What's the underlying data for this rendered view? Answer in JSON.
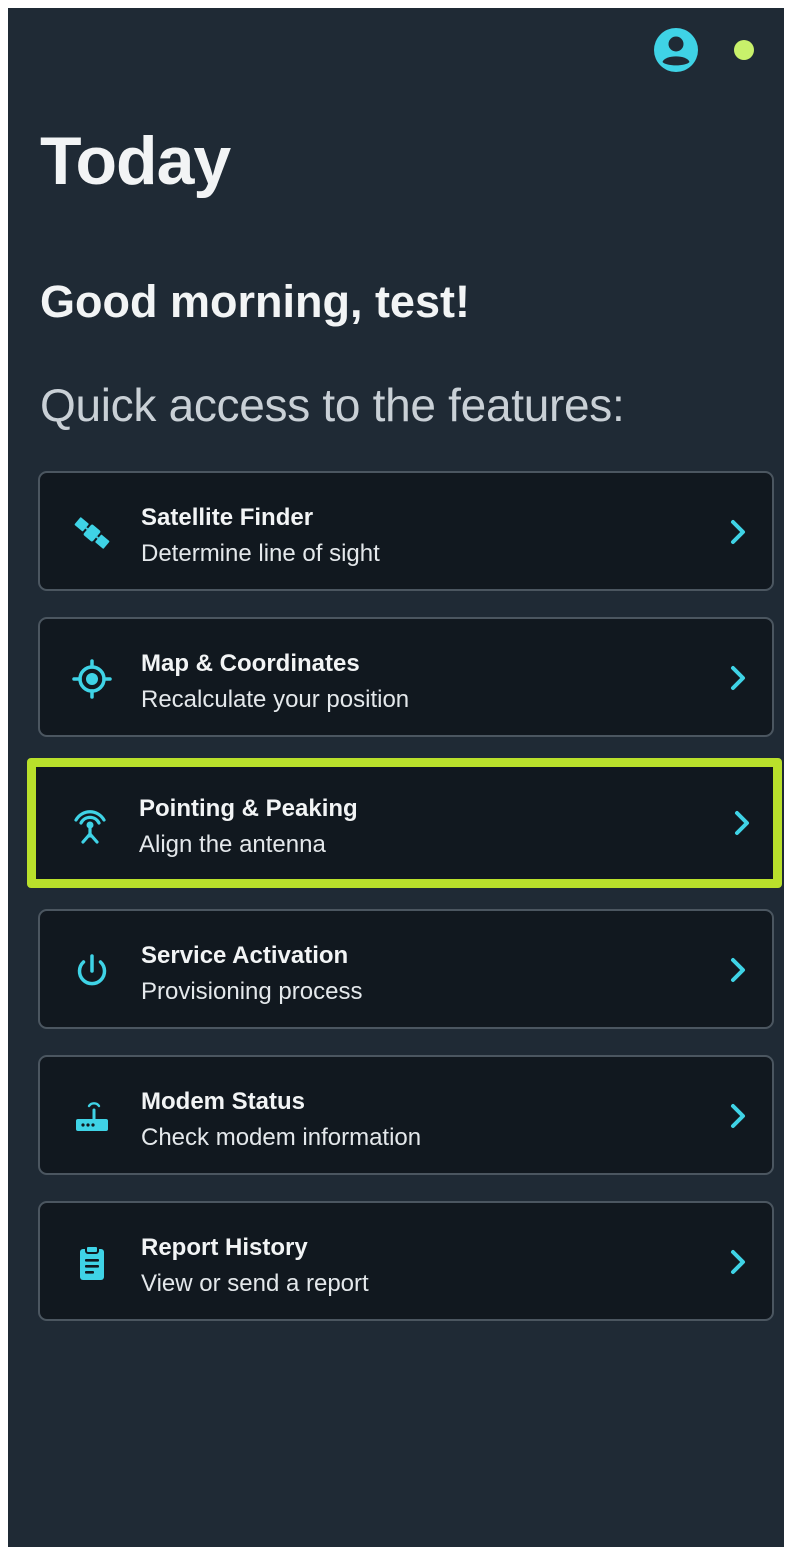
{
  "header": {
    "avatar_icon": "account-circle-icon",
    "status_dot_color": "#c8f16b"
  },
  "page": {
    "title": "Today",
    "greeting": "Good morning, test!",
    "section_heading": "Quick access to the features:"
  },
  "colors": {
    "background": "#1f2a35",
    "card_background": "#11181f",
    "accent_icon": "#3fd3e6",
    "highlight_border": "#b9e02b"
  },
  "features": [
    {
      "title": "Satellite Finder",
      "subtitle": "Determine line of sight",
      "icon": "satellite-icon",
      "highlighted": false
    },
    {
      "title": "Map & Coordinates",
      "subtitle": "Recalculate your position",
      "icon": "crosshair-location-icon",
      "highlighted": false
    },
    {
      "title": "Pointing & Peaking",
      "subtitle": "Align the antenna",
      "icon": "antenna-signal-icon",
      "highlighted": true
    },
    {
      "title": "Service Activation",
      "subtitle": "Provisioning process",
      "icon": "power-icon",
      "highlighted": false
    },
    {
      "title": "Modem Status",
      "subtitle": "Check modem information",
      "icon": "modem-router-icon",
      "highlighted": false
    },
    {
      "title": "Report History",
      "subtitle": "View or send a report",
      "icon": "clipboard-report-icon",
      "highlighted": false
    }
  ]
}
